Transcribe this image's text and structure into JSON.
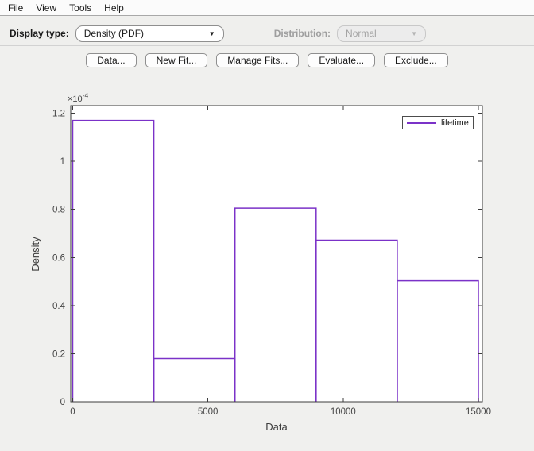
{
  "menu": {
    "items": [
      {
        "label": "File"
      },
      {
        "label": "View"
      },
      {
        "label": "Tools"
      },
      {
        "label": "Help"
      }
    ]
  },
  "toolbar": {
    "display_type_label": "Display type:",
    "display_type_value": "Density (PDF)",
    "distribution_label": "Distribution:",
    "distribution_value": "Normal",
    "distribution_enabled": false
  },
  "actions": {
    "buttons": [
      {
        "label": "Data..."
      },
      {
        "label": "New Fit..."
      },
      {
        "label": "Manage Fits..."
      },
      {
        "label": "Evaluate..."
      },
      {
        "label": "Exclude..."
      }
    ]
  },
  "chart_data": {
    "type": "bar",
    "subtype": "histogram",
    "title": "",
    "xlabel": "Data",
    "ylabel": "Density",
    "y_multiplier_base": "×10",
    "y_multiplier_exp": "-4",
    "bin_edges": [
      0,
      3000,
      6000,
      9000,
      12000,
      15000
    ],
    "values": [
      0.000117,
      1.8e-05,
      8.05e-05,
      6.72e-05,
      5.03e-05
    ],
    "values_e4": [
      1.17,
      0.18,
      0.805,
      0.672,
      0.503
    ],
    "x_ticks": [
      0,
      5000,
      10000,
      15000
    ],
    "x_tick_labels": [
      "0",
      "5000",
      "10000",
      "15000"
    ],
    "y_ticks_e4": [
      0,
      0.2,
      0.4,
      0.6,
      0.8,
      1,
      1.2
    ],
    "y_tick_labels": [
      "0",
      "0.2",
      "0.4",
      "0.6",
      "0.8",
      "1",
      "1.2"
    ],
    "xlim": [
      0,
      15000
    ],
    "ylim_e4": [
      0,
      1.233
    ],
    "grid": false,
    "legend": {
      "position": "top-right",
      "entries": [
        {
          "label": "lifetime",
          "color": "#7b32c8"
        }
      ]
    },
    "series_color": "#7b32c8"
  },
  "colors": {
    "accent_purple": "#7b32c8",
    "window_bg": "#f0f0ee",
    "plot_bg": "#ffffff",
    "axis": "#3c3c3c",
    "tick_text": "#444444"
  }
}
